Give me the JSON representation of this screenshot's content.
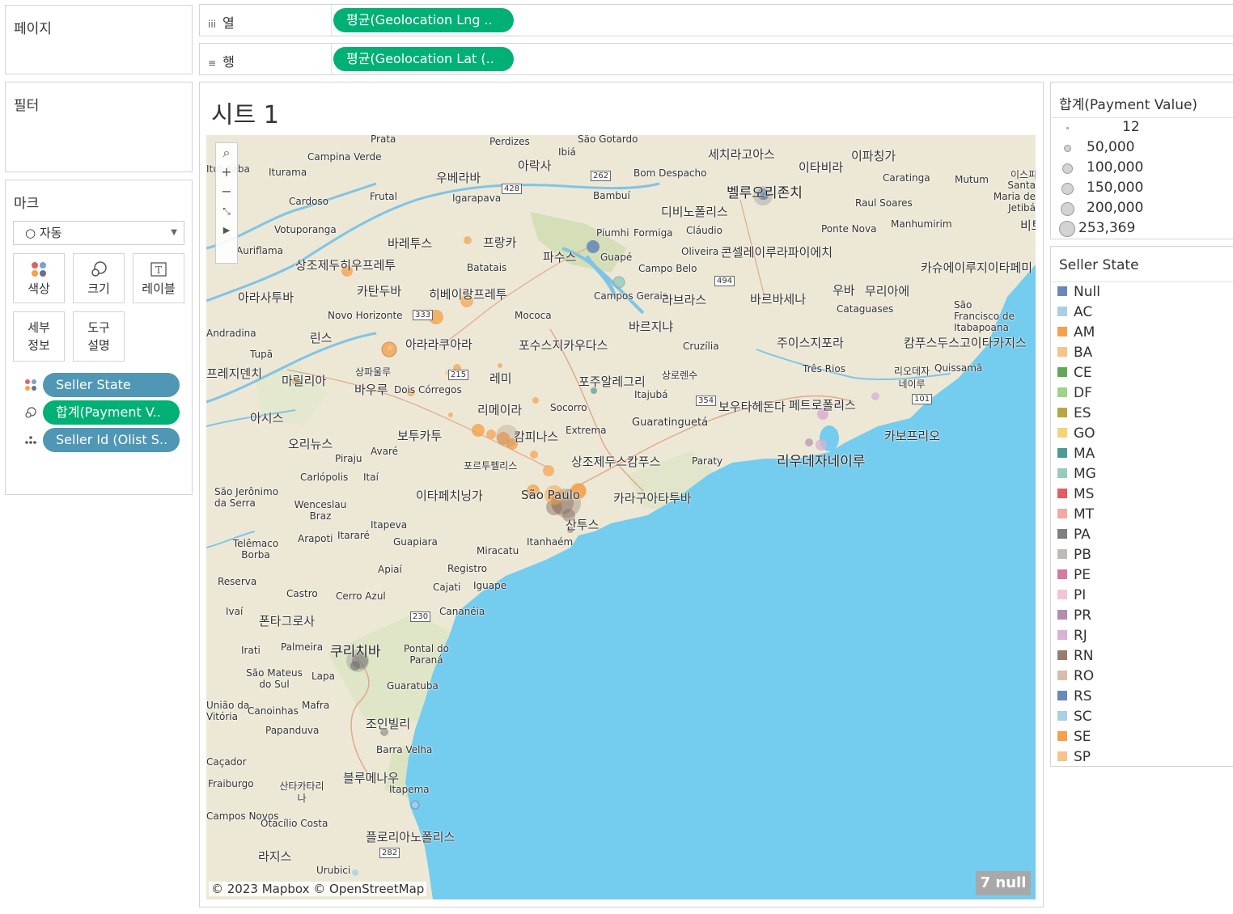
{
  "panels": {
    "pages": "페이지",
    "filters": "필터",
    "marks": "마크"
  },
  "shelves": {
    "columns": {
      "icon": "iii",
      "label": "열",
      "pill": "평균(Geolocation Lng .."
    },
    "rows": {
      "icon": "≡",
      "label": "행",
      "pill": "평균(Geolocation Lat (.."
    }
  },
  "marks": {
    "mark_type": "○ 자동",
    "buttons": {
      "color": "색상",
      "size": "크기",
      "label": "레이블",
      "detail_line1": "세부",
      "detail_line2": "정보",
      "tooltip_line1": "도구",
      "tooltip_line2": "설명"
    },
    "fields": [
      {
        "icon": "color-dots-icon",
        "label": "Seller State",
        "color": "#4f97b5"
      },
      {
        "icon": "size-icon",
        "label": "합계(Payment V..",
        "color": "#00b074"
      },
      {
        "icon": "detail-dots-icon",
        "label": "Seller Id (Olist S..",
        "color": "#4f97b5"
      }
    ]
  },
  "sheet": {
    "title": "시트 1",
    "attribution": "© 2023 Mapbox © OpenStreetMap",
    "null_badge": "7 null"
  },
  "map_labels": {
    "l1": "Prata",
    "l2": "Perdizes",
    "l3": "São Gotardo",
    "l4": "세치라고아스",
    "l5": "이파칭가",
    "l6": "Campina Verde",
    "l7": "Ibiá",
    "l8": "아락사",
    "l9": "이타비라",
    "l10": "이스피",
    "l11": "Ituiutaba",
    "l12": "Iturama",
    "l13": "우베라바",
    "l14": "Bom Despacho",
    "l15": "Caratinga",
    "l16": "Mutum",
    "l17": "Santa Maria de Jetibá",
    "l18": "벨루오리존치",
    "l19": "Cardoso",
    "l20": "Frutal",
    "l21": "Igarapava",
    "l22": "Bambuí",
    "l23": "디비노폴리스",
    "l24": "Raul Soares",
    "l25": "Votuporanga",
    "l26": "Manhumirim",
    "l27": "비토",
    "l28": "프랑카",
    "l29": "바레투스",
    "l30": "Piumhi",
    "l31": "Formiga",
    "l32": "Cláudio",
    "l33": "Ponte Nova",
    "l34": "Auriflama",
    "l35": "파수스",
    "l36": "Guapé",
    "l37": "Oliveira",
    "l38": "콘셀레이루라파이에치",
    "l39": "상조제두히우프레투",
    "l40": "Batatais",
    "l41": "Campo Belo",
    "l42": "카슈에이루지이타페미",
    "l43": "카탄두바",
    "l44": "히베이랑프레투",
    "l45": "Campos Gerais",
    "l46": "라브라스",
    "l47": "바르바세나",
    "l48": "우바",
    "l49": "무리아에",
    "l50": "아라사투바",
    "l51": "Novo Horizonte",
    "l52": "Mococa",
    "l53": "바르지냐",
    "l54": "Cataguases",
    "l55": "São Francisco de Itabapoana",
    "l56": "Andradina",
    "l57": "린스",
    "l58": "아라라쿠아라",
    "l59": "포수스지카우다스",
    "l60": "주이스지포라",
    "l61": "캄푸스두스고이타카지스",
    "l62": "Tupã",
    "l63": "Cruzília",
    "l64": "프레지덴치",
    "l65": "마릴리아",
    "l66": "상파울루",
    "l67": "레미",
    "l68": "포주알레그리",
    "l69": "상로렌수",
    "l70": "Três Rios",
    "l71": "리오데자네이루",
    "l72": "Quissamã",
    "l73": "바우루",
    "l74": "Dois Córregos",
    "l75": "Itajubá",
    "l76": "아시스",
    "l77": "리메이라",
    "l78": "Socorro",
    "l79": "보우타헤돈다",
    "l80": "페트로폴리스",
    "l81": "Guaratinguetá",
    "l82": "보투카투",
    "l83": "캄피나스",
    "l84": "Extrema",
    "l85": "카보프리오",
    "l86": "오리뉴스",
    "l87": "Piraju",
    "l88": "Avaré",
    "l89": "포르투펠리스",
    "l90": "상조제두스캄푸스",
    "l91": "Paraty",
    "l92": "리우데자네이루",
    "l93": "Carlópolis",
    "l94": "Itaí",
    "l95": "São Jerônimo da Serra",
    "l96": "이타페치닝가",
    "l97": "카라구아타투바",
    "l98": "Wenceslau Braz",
    "l99": "Itapeva",
    "l100": "산투스",
    "l101": "Telêmaco Borba",
    "l102": "Arapoti",
    "l103": "Itararé",
    "l104": "Guapiara",
    "l105": "Itanhaém",
    "l106": "Miracatu",
    "l107": "Apiaí",
    "l108": "Registro",
    "l109": "Reserva",
    "l110": "Castro",
    "l111": "Cajati",
    "l112": "Iguape",
    "l113": "Cerro Azul",
    "l114": "Ivaí",
    "l115": "폰타그로사",
    "l116": "Cananéia",
    "l117": "Irati",
    "l118": "Palmeira",
    "l119": "쿠리치바",
    "l120": "Pontal do Paraná",
    "l121": "São Mateus do Sul",
    "l122": "Lapa",
    "l123": "Guaratuba",
    "l124": "União da Vitória",
    "l125": "Canoinhas",
    "l126": "Mafra",
    "l127": "조인빌리",
    "l128": "Papanduva",
    "l129": "Barra Velha",
    "l130": "Caçador",
    "l131": "Fraiburgo",
    "l132": "블루메나우",
    "l133": "Itapema",
    "l134": "산타카타리나",
    "l135": "Campos Novos",
    "l136": "Otacílio Costa",
    "l137": "플로리아노폴리스",
    "l138": "라지스",
    "l139": "Urubici",
    "l140": "São Paulo"
  },
  "road_badges": [
    "262",
    "428",
    "494",
    "333",
    "215",
    "354",
    "101",
    "230",
    "282"
  ],
  "size_legend": {
    "title": "합계(Payment Value)",
    "items": [
      {
        "value": "12",
        "d": 3
      },
      {
        "value": "50,000",
        "d": 9
      },
      {
        "value": "100,000",
        "d": 13
      },
      {
        "value": "150,000",
        "d": 15
      },
      {
        "value": "200,000",
        "d": 17
      },
      {
        "value": "253,369",
        "d": 20
      }
    ]
  },
  "color_legend": {
    "title": "Seller State",
    "items": [
      {
        "label": "Null",
        "color": "#6a89b8"
      },
      {
        "label": "AC",
        "color": "#a9cfe4"
      },
      {
        "label": "AM",
        "color": "#f4a14c"
      },
      {
        "label": "BA",
        "color": "#f6c38c"
      },
      {
        "label": "CE",
        "color": "#5fa959"
      },
      {
        "label": "DF",
        "color": "#9fd28b"
      },
      {
        "label": "ES",
        "color": "#b9a642"
      },
      {
        "label": "GO",
        "color": "#f5d478"
      },
      {
        "label": "MA",
        "color": "#4b9b94"
      },
      {
        "label": "MG",
        "color": "#97c9c0"
      },
      {
        "label": "MS",
        "color": "#e25c61"
      },
      {
        "label": "MT",
        "color": "#f4a7a3"
      },
      {
        "label": "PA",
        "color": "#7f7f7f"
      },
      {
        "label": "PB",
        "color": "#bfbab7"
      },
      {
        "label": "PE",
        "color": "#d77aa2"
      },
      {
        "label": "PI",
        "color": "#f4c3d6"
      },
      {
        "label": "PR",
        "color": "#b38daf"
      },
      {
        "label": "RJ",
        "color": "#d8b2d2"
      },
      {
        "label": "RN",
        "color": "#9a7c6e"
      },
      {
        "label": "RO",
        "color": "#d8bcae"
      },
      {
        "label": "RS",
        "color": "#6a89b8"
      },
      {
        "label": "SC",
        "color": "#a9cfe4"
      },
      {
        "label": "SE",
        "color": "#f4a14c"
      },
      {
        "label": "SP",
        "color": "#f6c38c"
      }
    ]
  },
  "colors": {
    "green_pill": "#00b074",
    "blue_pill": "#4f97b5",
    "ocean": "#74ccee",
    "land": "#ede8d6"
  }
}
